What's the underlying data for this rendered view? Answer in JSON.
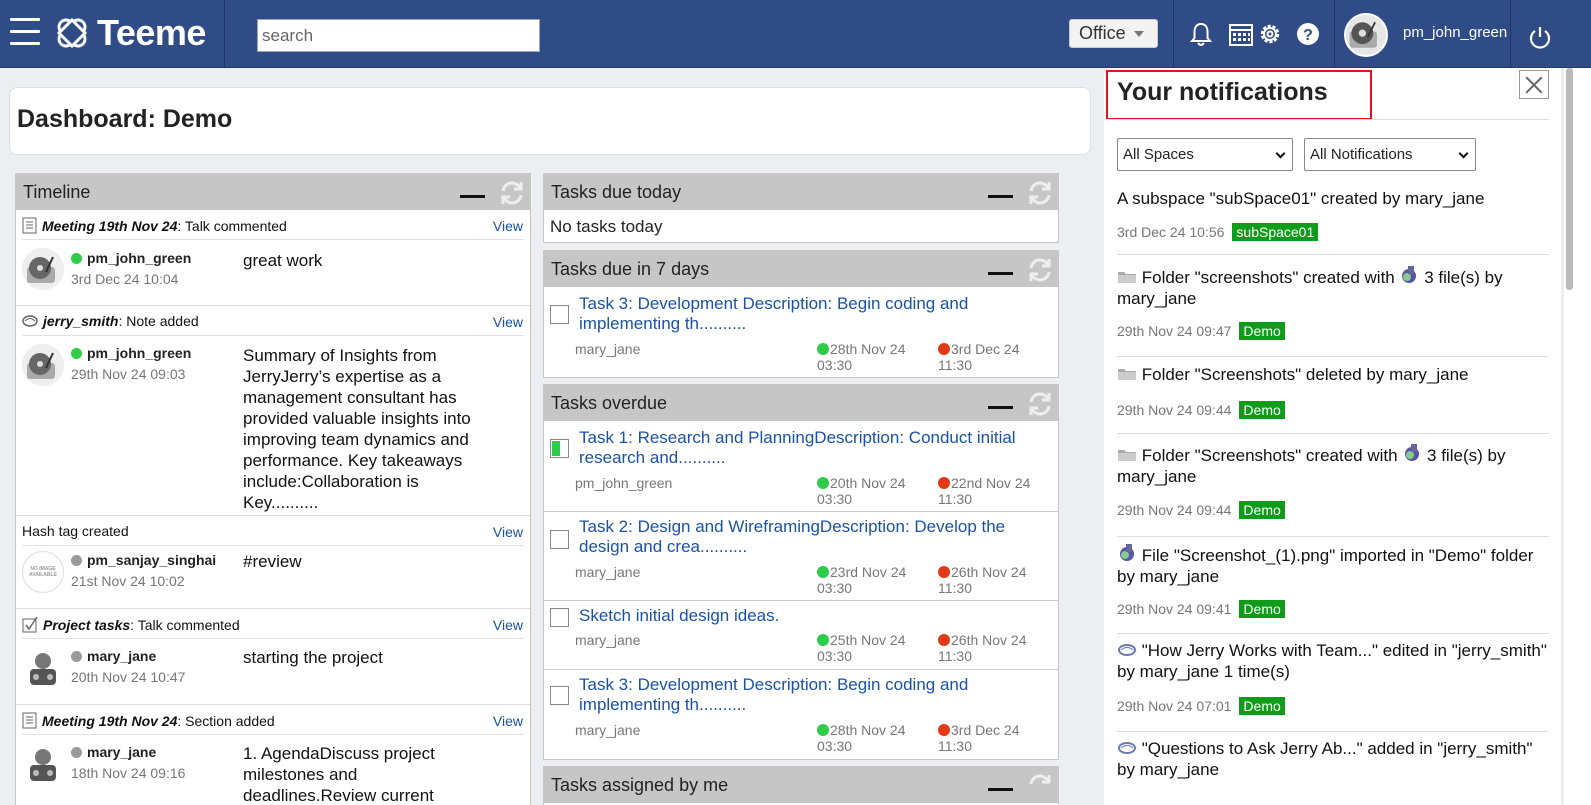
{
  "header": {
    "app_name": "Teeme",
    "search_placeholder": "search",
    "space_selector": "Office",
    "username": "pm_john_green"
  },
  "dashboard": {
    "title": "Dashboard: Demo"
  },
  "timeline": {
    "title": "Timeline",
    "view_label": "View",
    "items": [
      {
        "context": "Meeting 19th Nov 24",
        "action": ": Talk commented",
        "user": "pm_john_green",
        "time": "3rd Dec 24 10:04",
        "text": "great work"
      },
      {
        "context": "jerry_smith",
        "action": ": Note added",
        "user": "pm_john_green",
        "time": "29th Nov 24 09:03",
        "text": "Summary of Insights from JerryJerry’s expertise as a management consultant has provided valuable insights into improving team dynamics and performance. Key takeaways include:Collaboration is Key.........."
      },
      {
        "context": "",
        "action": "Hash tag created",
        "user": "pm_sanjay_singhai",
        "time": "21st Nov 24 10:02",
        "text": "#review",
        "avatar_text": "NO IMAGE AVAILABLE"
      },
      {
        "context": "Project tasks",
        "action": ": Talk commented",
        "user": "mary_jane",
        "time": "20th Nov 24 10:47",
        "text": "starting the project"
      },
      {
        "context": "Meeting 19th Nov 24",
        "action": ": Section added",
        "user": "mary_jane",
        "time": "18th Nov 24 09:16",
        "text": "1. AgendaDiscuss project milestones and deadlines.Review current"
      }
    ]
  },
  "tasks_today": {
    "title": "Tasks due today",
    "empty": "No tasks today"
  },
  "tasks_week": {
    "title": "Tasks due in 7 days",
    "items": [
      {
        "title": "Task 3: Development Description: Begin coding and implementing th..........",
        "who": "mary_jane",
        "start_d": "28th Nov 24",
        "start_t": "03:30",
        "end_d": "3rd Dec 24",
        "end_t": "11:30"
      }
    ]
  },
  "tasks_overdue": {
    "title": "Tasks overdue",
    "items": [
      {
        "title": "Task 1: Research and PlanningDescription: Conduct initial research and..........",
        "who": "pm_john_green",
        "start_d": "20th Nov 24",
        "start_t": "03:30",
        "end_d": "22nd Nov 24",
        "end_t": "11:30"
      },
      {
        "title": "Task 2: Design and WireframingDescription: Develop the design and crea..........",
        "who": "mary_jane",
        "start_d": "23rd Nov 24",
        "start_t": "03:30",
        "end_d": "26th Nov 24",
        "end_t": "11:30"
      },
      {
        "title": "Sketch initial design ideas.",
        "who": "mary_jane",
        "start_d": "25th Nov 24",
        "start_t": "03:30",
        "end_d": "26th Nov 24",
        "end_t": "11:30"
      },
      {
        "title": "Task 3: Development Description: Begin coding and implementing th..........",
        "who": "mary_jane",
        "start_d": "28th Nov 24",
        "start_t": "03:30",
        "end_d": "3rd Dec 24",
        "end_t": "11:30"
      }
    ]
  },
  "tasks_assigned": {
    "title": "Tasks assigned by me"
  },
  "notifications": {
    "title": "Your notifications",
    "filter_space": "All Spaces",
    "filter_type": "All Notifications",
    "items": [
      {
        "pre": "A subspace \"subSpace01\" created by mary_jane",
        "post": "",
        "time": "3rd Dec 24 10:56",
        "badge": "subSpace01"
      },
      {
        "pre": "Folder \"screenshots\" created with ",
        "post": " 3 file(s) by mary_jane",
        "time": "29th Nov 24 09:47",
        "badge": "Demo"
      },
      {
        "pre": "Folder \"Screenshots\" deleted by mary_jane",
        "post": "",
        "time": "29th Nov 24 09:44",
        "badge": "Demo"
      },
      {
        "pre": "Folder \"Screenshots\" created with ",
        "post": " 3 file(s) by mary_jane",
        "time": "29th Nov 24 09:44",
        "badge": "Demo"
      },
      {
        "pre": "File \"Screenshot_(1).png\" imported in \"Demo\" folder by mary_jane",
        "post": "",
        "time": "29th Nov 24 09:41",
        "badge": "Demo"
      },
      {
        "pre": "\"How Jerry Works with Team...\" edited in \"jerry_smith\" by mary_jane 1 time(s)",
        "post": "",
        "time": "29th Nov 24 07:01",
        "badge": "Demo"
      },
      {
        "pre": "\"Questions to Ask Jerry Ab...\" added in \"jerry_smith\" by mary_jane",
        "post": "",
        "time": "",
        "badge": ""
      }
    ]
  }
}
